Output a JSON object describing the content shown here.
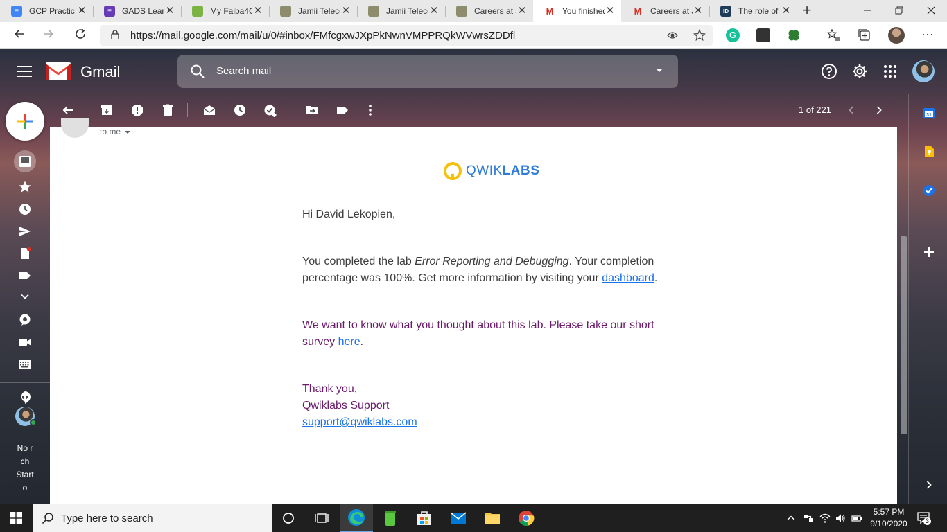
{
  "browser": {
    "tabs": [
      {
        "title": "GCP Practic",
        "favicon_color": "#4285f4",
        "active": false
      },
      {
        "title": "GADS Learr",
        "favicon_color": "#673ab7",
        "active": false
      },
      {
        "title": "My Faiba4G",
        "favicon_color": "#7cb342",
        "active": false
      },
      {
        "title": "Jamii Teleco",
        "favicon_color": "#8d8d6e",
        "active": false
      },
      {
        "title": "Jamii Teleco",
        "favicon_color": "#8d8d6e",
        "active": false
      },
      {
        "title": "Careers at J",
        "favicon_color": "#8d8d6e",
        "active": false
      },
      {
        "title": "You finished",
        "favicon_color": "#d93025",
        "active": true
      },
      {
        "title": "Careers at J",
        "favicon_color": "#d93025",
        "active": false
      },
      {
        "title": "The role of",
        "favicon_color": "#1f3b5a",
        "active": false
      }
    ],
    "new_tab_symbol": "+",
    "close_symbol": "✕",
    "url": "https://mail.google.com/mail/u/0/#inbox/FMfcgxwJXpPkNwnVMPPRQkWVwrsZDDfl"
  },
  "gmail": {
    "app_name": "Gmail",
    "search_placeholder": "Search mail",
    "pager": "1 of 221",
    "recipient": "to me",
    "rail_text_lines": [
      "No r",
      "ch",
      "Start",
      "o"
    ]
  },
  "email": {
    "brand_prefix": "QWIK",
    "brand_suffix": "LABS",
    "greeting": "Hi David Lekopien,",
    "p1_before": "You completed the lab ",
    "p1_lab": "Error Reporting and Debugging",
    "p1_after": ". Your completion percentage was 100%. Get more information by visiting your ",
    "p1_link": "dashboard",
    "p1_end": ".",
    "p2_before": "We want to know what you thought about this lab. Please take our short survey ",
    "p2_link": "here",
    "p2_end": ".",
    "signoff": "Thank you,",
    "signature": "Qwiklabs Support",
    "support_email": "support@qwiklabs.com"
  },
  "taskbar": {
    "search_placeholder": "Type here to search",
    "time": "5:57 PM",
    "date": "9/10/2020",
    "notification_count": "3"
  },
  "colors": {
    "gmail_red": "#ea4335",
    "qwiklabs_blue": "#2f7bd8",
    "qwiklabs_yellow": "#f4c20d",
    "link_blue": "#1a73e8",
    "survey_purple": "#6a1b6a"
  }
}
